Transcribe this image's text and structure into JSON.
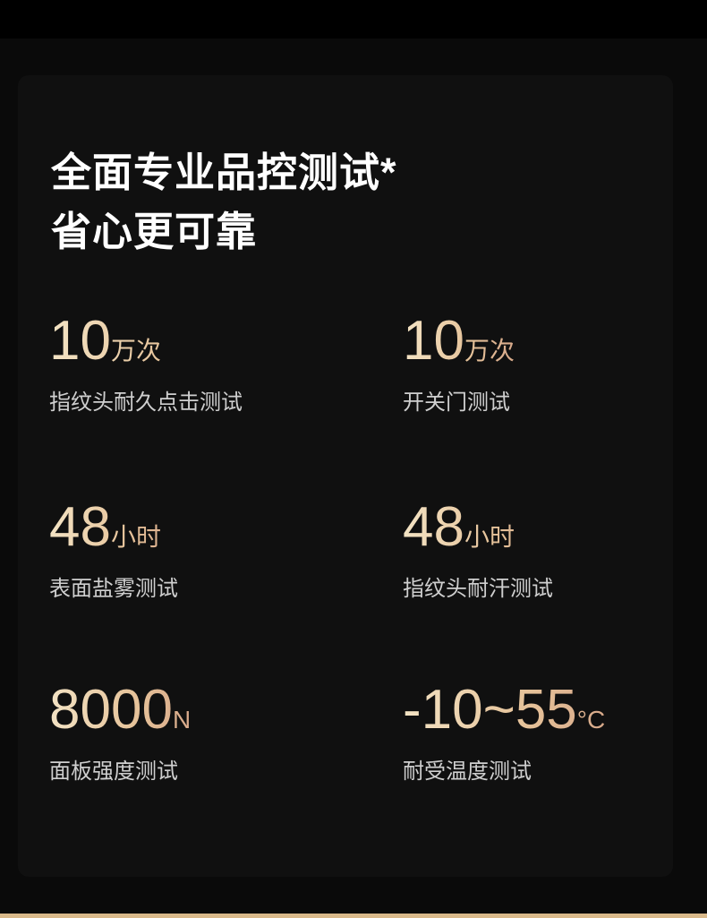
{
  "title_line1": "全面专业品控测试*",
  "title_line2": "省心更可靠",
  "accent_color": "#e6c39a",
  "stats": [
    {
      "value": "10",
      "unit": "万次",
      "label": "指纹头耐久点击测试"
    },
    {
      "value": "10",
      "unit": "万次",
      "label": "开关门测试"
    },
    {
      "value": "48",
      "unit": "小时",
      "label": "表面盐雾测试"
    },
    {
      "value": "48",
      "unit": "小时",
      "label": "指纹头耐汗测试"
    },
    {
      "value": "8000",
      "unit": "N",
      "label": "面板强度测试"
    },
    {
      "value": "-10~55",
      "unit": "°C",
      "label": "耐受温度测试"
    }
  ]
}
